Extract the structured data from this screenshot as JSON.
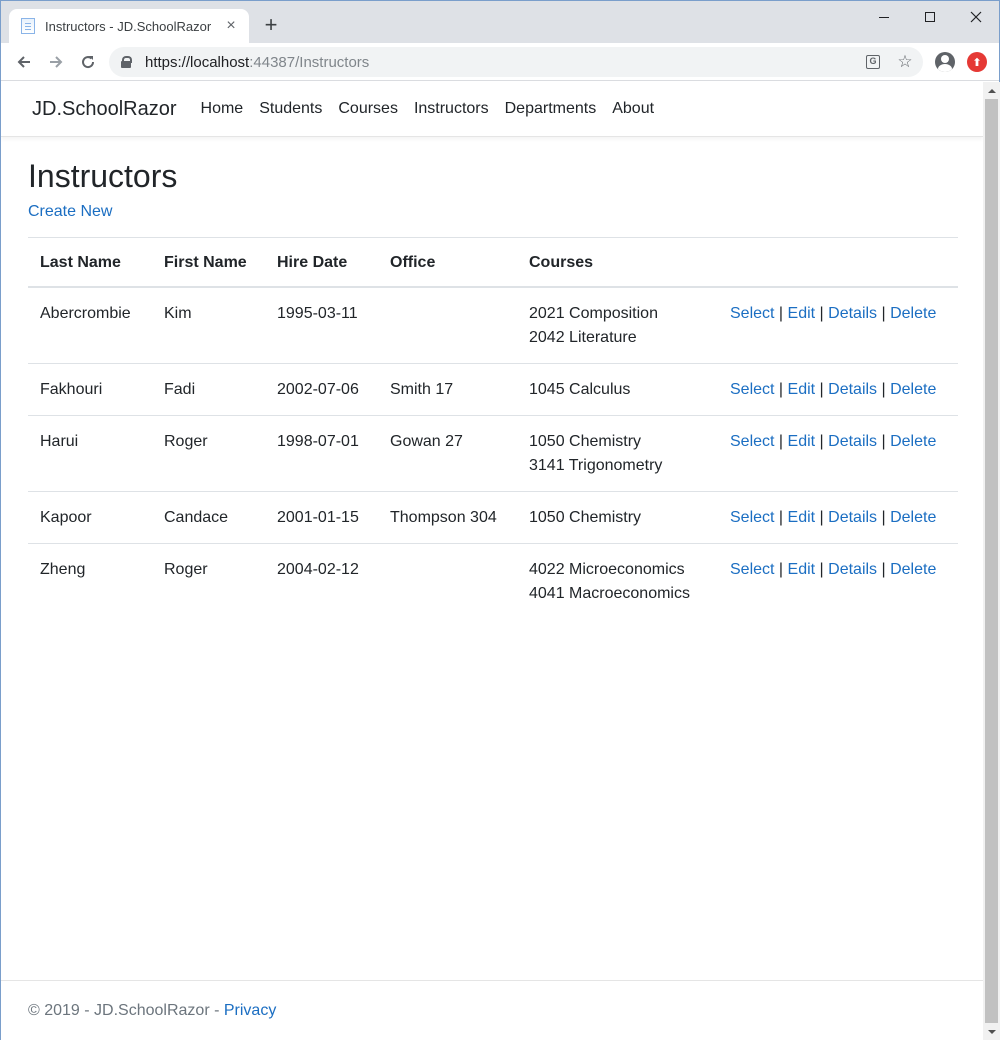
{
  "browser": {
    "tab_title": "Instructors - JD.SchoolRazor",
    "tab_close": "×",
    "new_tab": "+",
    "url_host": "https://localhost",
    "url_rest": ":44387/Instructors"
  },
  "navbar": {
    "brand": "JD.SchoolRazor",
    "links": [
      "Home",
      "Students",
      "Courses",
      "Instructors",
      "Departments",
      "About"
    ]
  },
  "page": {
    "title": "Instructors",
    "create_new": "Create New"
  },
  "table": {
    "headers": [
      "Last Name",
      "First Name",
      "Hire Date",
      "Office",
      "Courses",
      ""
    ],
    "actions": [
      "Select",
      "Edit",
      "Details",
      "Delete"
    ],
    "rows": [
      {
        "last": "Abercrombie",
        "first": "Kim",
        "hire": "1995-03-11",
        "office": "",
        "courses": [
          "2021 Composition",
          "2042 Literature"
        ]
      },
      {
        "last": "Fakhouri",
        "first": "Fadi",
        "hire": "2002-07-06",
        "office": "Smith 17",
        "courses": [
          "1045 Calculus"
        ]
      },
      {
        "last": "Harui",
        "first": "Roger",
        "hire": "1998-07-01",
        "office": "Gowan 27",
        "courses": [
          "1050 Chemistry",
          "3141 Trigonometry"
        ]
      },
      {
        "last": "Kapoor",
        "first": "Candace",
        "hire": "2001-01-15",
        "office": "Thompson 304",
        "courses": [
          "1050 Chemistry"
        ]
      },
      {
        "last": "Zheng",
        "first": "Roger",
        "hire": "2004-02-12",
        "office": "",
        "courses": [
          "4022 Microeconomics",
          "4041 Macroeconomics"
        ]
      }
    ]
  },
  "footer": {
    "text": "© 2019 - JD.SchoolRazor - ",
    "privacy": "Privacy"
  },
  "colors": {
    "link": "#1b6ec2",
    "text": "#212529"
  }
}
